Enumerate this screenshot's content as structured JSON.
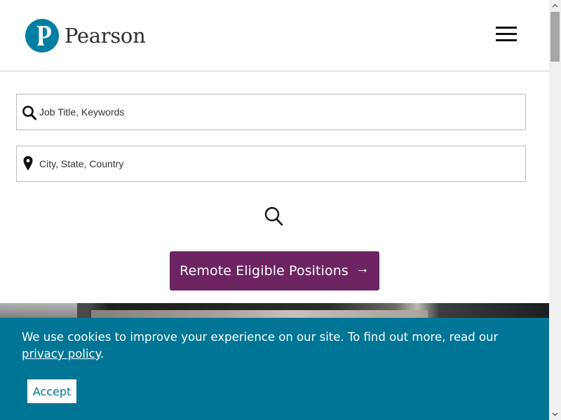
{
  "header": {
    "brand_name": "Pearson",
    "logo_letter": "P",
    "logo_icon": "pearson-logo-icon",
    "menu_icon": "hamburger-menu-icon",
    "colors": {
      "logo_blue": "#007fa3",
      "brand_text": "#2f2f2f"
    }
  },
  "search": {
    "keywords_placeholder": "Job Title, Keywords",
    "keywords_value": "",
    "keywords_icon": "search-icon",
    "location_placeholder": "City, State, Country",
    "location_value": "",
    "location_icon": "map-pin-icon",
    "submit_icon": "search-icon"
  },
  "remote_button": {
    "label": "Remote Eligible Positions",
    "arrow": "→",
    "color": "#6c2462"
  },
  "cookie_banner": {
    "text_before_link": "We use cookies to improve your experience on our site. To find out more, read our ",
    "link_text": "privacy policy",
    "text_after_link": ".",
    "accept_label": "Accept",
    "color": "#007595"
  }
}
